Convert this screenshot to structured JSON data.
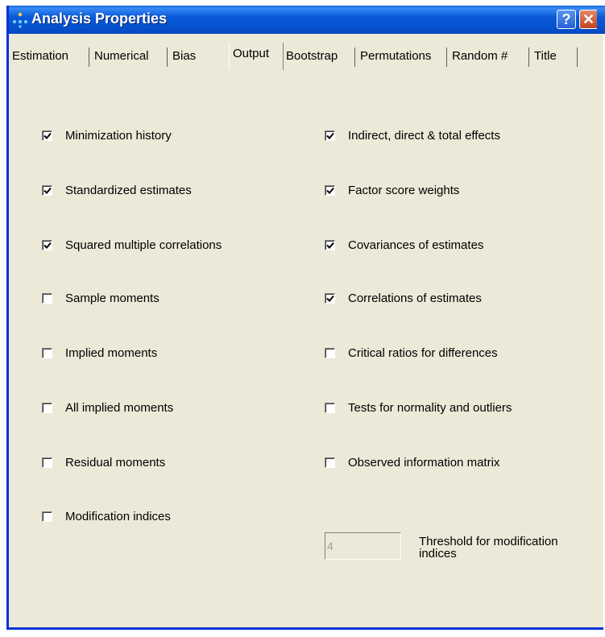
{
  "window": {
    "title": "Analysis Properties",
    "help_label": "?",
    "close_label": "✕"
  },
  "tabs": [
    {
      "label": "Estimation",
      "selected": false
    },
    {
      "label": "Numerical",
      "selected": false
    },
    {
      "label": "Bias",
      "selected": false
    },
    {
      "label": "Output",
      "selected": true
    },
    {
      "label": "Bootstrap",
      "selected": false
    },
    {
      "label": "Permutations",
      "selected": false
    },
    {
      "label": "Random #",
      "selected": false
    },
    {
      "label": "Title",
      "selected": false
    }
  ],
  "left_options": [
    {
      "label": "Minimization history",
      "checked": true
    },
    {
      "label": "Standardized estimates",
      "checked": true
    },
    {
      "label": "Squared multiple correlations",
      "checked": true
    },
    {
      "label": "Sample moments",
      "checked": false
    },
    {
      "label": "Implied moments",
      "checked": false
    },
    {
      "label": "All implied moments",
      "checked": false
    },
    {
      "label": "Residual moments",
      "checked": false
    },
    {
      "label": "Modification indices",
      "checked": false
    }
  ],
  "right_options": [
    {
      "label": "Indirect, direct & total effects",
      "checked": true
    },
    {
      "label": "Factor score weights",
      "checked": true
    },
    {
      "label": "Covariances of estimates",
      "checked": true
    },
    {
      "label": "Correlations of estimates",
      "checked": true
    },
    {
      "label": "Critical ratios for differences",
      "checked": false
    },
    {
      "label": "Tests for normality and outliers",
      "checked": false
    },
    {
      "label": "Observed information matrix",
      "checked": false
    }
  ],
  "threshold": {
    "value": "4",
    "label": "Threshold for modification indices"
  }
}
